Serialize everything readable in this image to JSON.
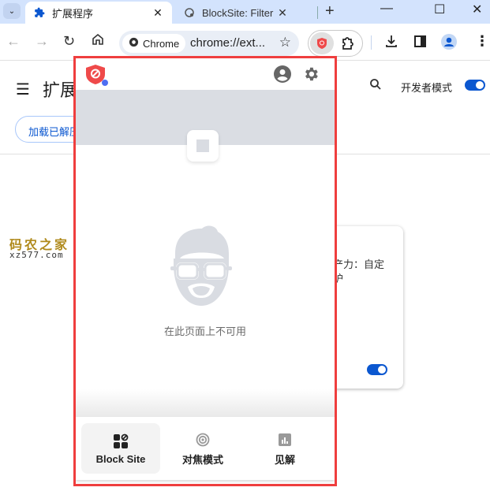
{
  "browser": {
    "tabs": [
      {
        "label": "扩展程序",
        "icon": "puzzle-icon",
        "active": true
      },
      {
        "label": "BlockSite: Filter Web",
        "icon": "globe-icon",
        "active": false
      }
    ],
    "new_tab": "+",
    "tab_menu": "⌄",
    "window": {
      "minimize": "—",
      "maximize": "☐",
      "close": "✕"
    },
    "omnibox": {
      "chip": "Chrome",
      "url": "chrome://ext..."
    }
  },
  "extensions_page": {
    "title": "扩展",
    "search_icon": "search-icon",
    "dev_mode_label": "开发者模式",
    "dev_mode_on": true,
    "load_button": "加载已解压",
    "card": {
      "text_line1": "产力：自定",
      "text_line2": "护",
      "enabled": true
    }
  },
  "watermark": {
    "line1": "码农之家",
    "line2": "xz577.com"
  },
  "popup": {
    "unavailable_text": "在此页面上不可用",
    "nav": [
      {
        "label": "Block Site",
        "icon": "grid-block-icon",
        "selected": true
      },
      {
        "label": "对焦模式",
        "icon": "target-icon",
        "selected": false
      },
      {
        "label": "见解",
        "icon": "bar-chart-icon",
        "selected": false
      }
    ]
  }
}
